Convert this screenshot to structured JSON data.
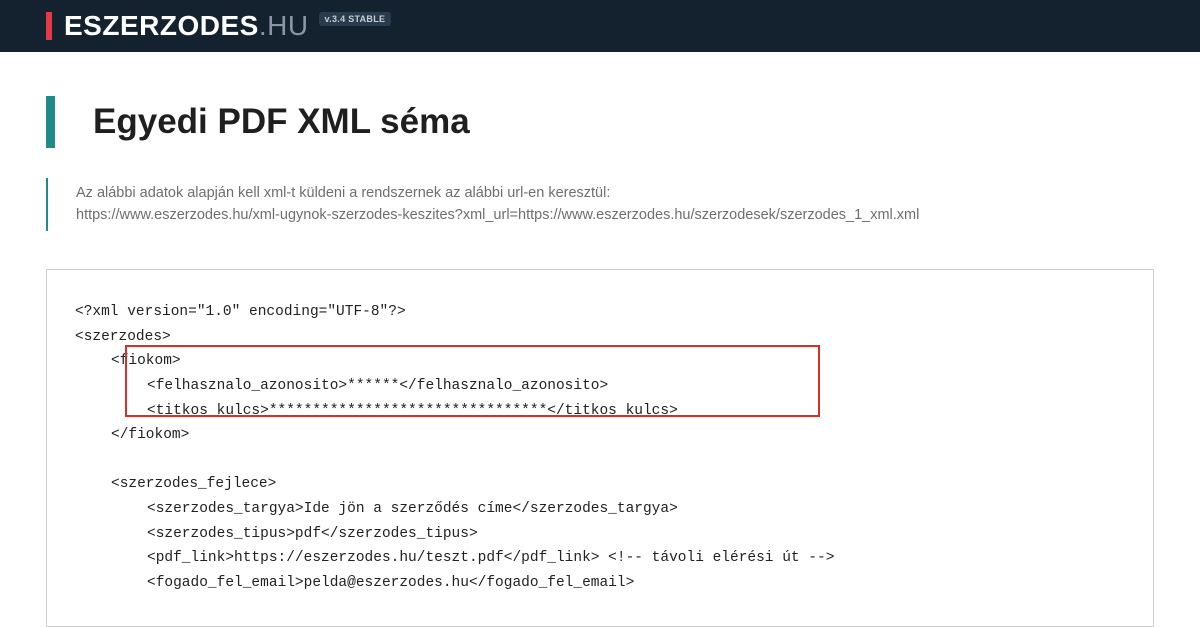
{
  "header": {
    "logo_main": "ESZERZODES",
    "logo_tld": ".HU",
    "version_badge": "v.3.4 STABLE"
  },
  "title": "Egyedi PDF XML séma",
  "subtitle_line1": "Az alábbi adatok alapján kell xml-t küldeni a rendszernek az alábbi url-en keresztül:",
  "subtitle_line2": "https://www.eszerzodes.hu/xml-ugynok-szerzodes-keszites?xml_url=https://www.eszerzodes.hu/szerzodesek/szerzodes_1_xml.xml",
  "code": {
    "l01": "<?xml version=\"1.0\" encoding=\"UTF-8\"?>",
    "l02": "<szerzodes>",
    "l03": "<fiokom>",
    "l04": "<felhasznalo_azonosito>******</felhasznalo_azonosito>",
    "l05": "<titkos_kulcs>********************************</titkos_kulcs>",
    "l06": "</fiokom>",
    "l07": "",
    "l08": "<szerzodes_fejlece>",
    "l09": "<szerzodes_targya>Ide jön a szerződés címe</szerzodes_targya>",
    "l10": "<szerzodes_tipus>pdf</szerzodes_tipus>",
    "l11": "<pdf_link>https://eszerzodes.hu/teszt.pdf</pdf_link> <!-- távoli elérési út -->",
    "l12": "<fogado_fel_email>pelda@eszerzodes.hu</fogado_fel_email>"
  }
}
